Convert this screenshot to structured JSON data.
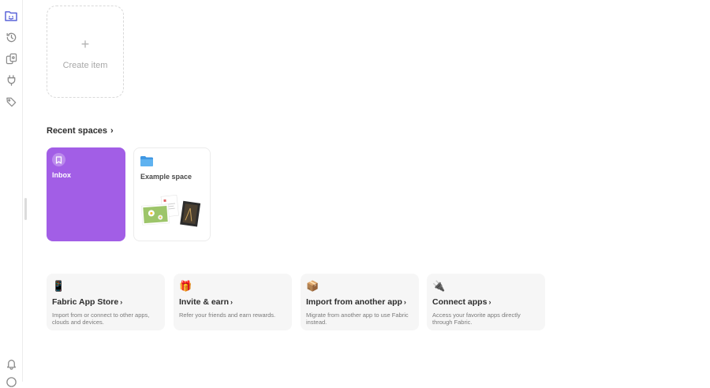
{
  "create": {
    "plus": "+",
    "label": "Create item"
  },
  "recent": {
    "title": "Recent spaces",
    "chevron": "›",
    "spaces": [
      {
        "name": "Inbox",
        "color": "#a25ee6",
        "icon": "bookmark-icon"
      },
      {
        "name": "Example space",
        "icon": "folder-icon"
      }
    ]
  },
  "cards": [
    {
      "emoji": "📱",
      "title": "Fabric App Store",
      "chevron": "›",
      "desc": "Import from or connect to other apps, clouds and devices."
    },
    {
      "emoji": "🎁",
      "title": "Invite & earn",
      "chevron": "›",
      "desc": "Refer your friends and earn rewards."
    },
    {
      "emoji": "📦",
      "title": "Import from another app",
      "chevron": "›",
      "desc": "Migrate from another app to use Fabric instead."
    },
    {
      "emoji": "🔌",
      "title": "Connect apps",
      "chevron": "›",
      "desc": "Access your favorite apps directly through Fabric."
    }
  ],
  "colors": {
    "accent": "#5a63d8",
    "inbox": "#a25ee6",
    "folder": "#4da3e8"
  }
}
